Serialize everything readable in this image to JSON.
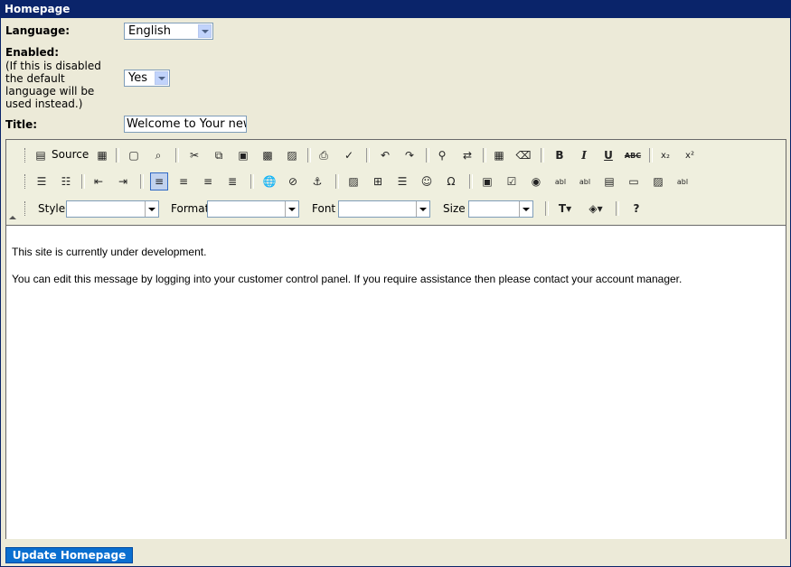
{
  "panel": {
    "title": "Homepage"
  },
  "form": {
    "language_label": "Language:",
    "language_value": "English",
    "enabled_label": "Enabled:",
    "enabled_note": "(If this is disabled the default language will be used instead.)",
    "enabled_value": "Yes",
    "title_label": "Title:",
    "title_value": "Welcome to Your new"
  },
  "toolbar": {
    "source_label": "Source",
    "style_label": "Style",
    "format_label": "Format",
    "font_label": "Font",
    "size_label": "Size",
    "icons_row1": [
      "source-icon",
      "templates-icon",
      "new-page-icon",
      "preview-icon",
      "cut-icon",
      "copy-icon",
      "paste-icon",
      "paste-text-icon",
      "paste-word-icon",
      "print-icon",
      "spellcheck-icon",
      "undo-icon",
      "redo-icon",
      "find-icon",
      "replace-icon",
      "select-all-icon",
      "remove-format-icon",
      "bold-icon",
      "italic-icon",
      "underline-icon",
      "strikethrough-icon",
      "subscript-icon",
      "superscript-icon"
    ],
    "icons_row2": [
      "ordered-list-icon",
      "unordered-list-icon",
      "outdent-icon",
      "indent-icon",
      "align-left-icon",
      "align-center-icon",
      "align-right-icon",
      "justify-icon",
      "link-icon",
      "unlink-icon",
      "anchor-icon",
      "image-icon",
      "table-icon",
      "horizontal-rule-icon",
      "smiley-icon",
      "special-char-icon",
      "form-icon",
      "checkbox-icon",
      "radio-icon",
      "text-field-icon",
      "textarea-icon",
      "select-field-icon",
      "button-icon",
      "image-button-icon",
      "hidden-field-icon"
    ],
    "icons_row3": [
      "text-color-icon",
      "background-color-icon",
      "about-icon"
    ]
  },
  "editor": {
    "line1": "This site is currently under development.",
    "line2": "You can edit this message by logging into your customer control panel. If you require assistance then please contact your account manager."
  },
  "actions": {
    "submit_label": "Update Homepage"
  }
}
